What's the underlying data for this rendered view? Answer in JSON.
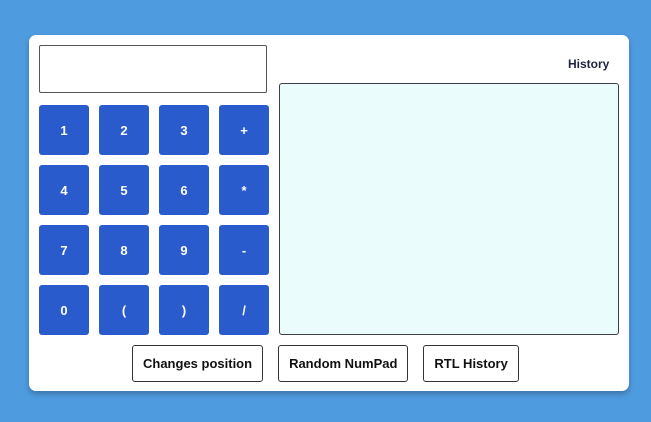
{
  "display": {
    "value": ""
  },
  "numpad": {
    "keys": [
      "1",
      "2",
      "3",
      "+",
      "4",
      "5",
      "6",
      "*",
      "7",
      "8",
      "9",
      "-",
      "0",
      "(",
      ")",
      "/"
    ]
  },
  "history": {
    "label": "History",
    "entries": []
  },
  "actions": {
    "change_position_label": "Changes position",
    "random_numpad_label": "Random NumPad",
    "rtl_history_label": "RTL History"
  },
  "colors": {
    "background": "#4f9be0",
    "key": "#2a5bcc",
    "history_bg": "#ebfcfc"
  }
}
